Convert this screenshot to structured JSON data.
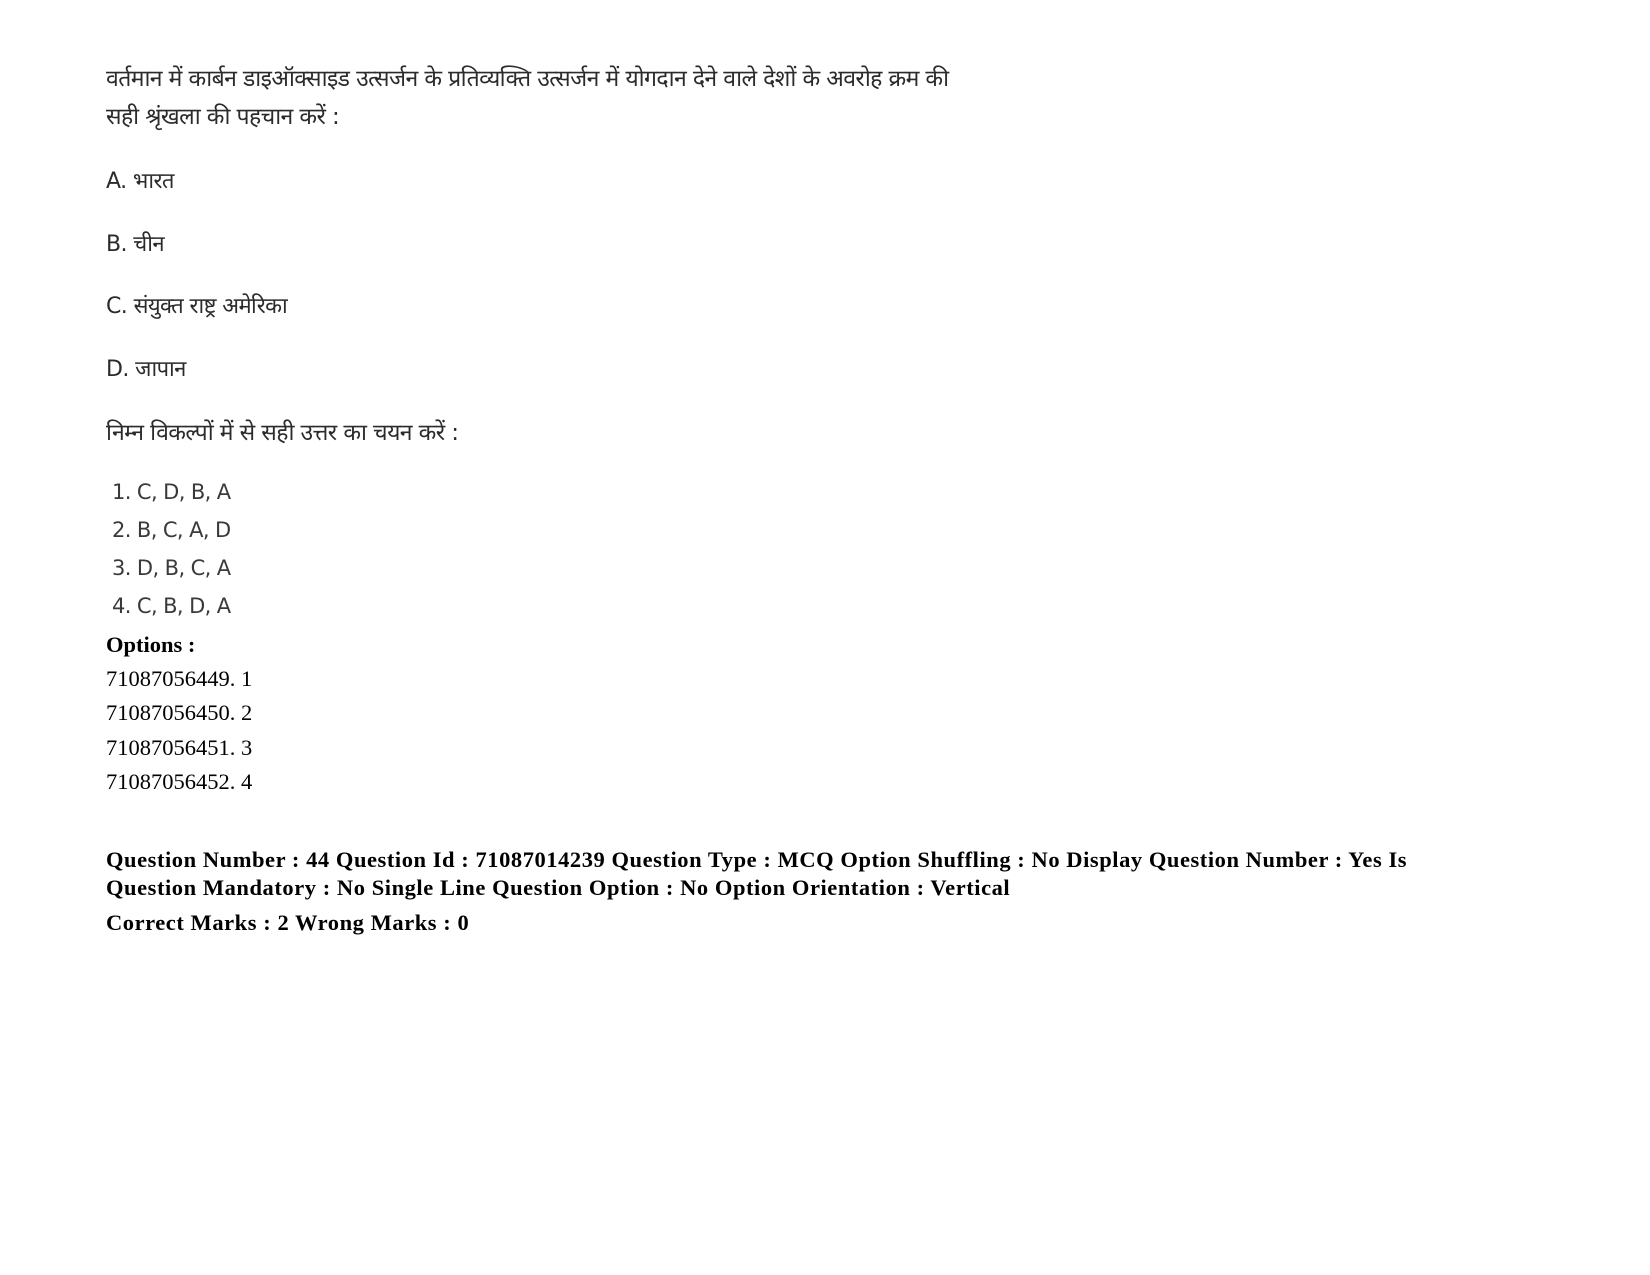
{
  "question": {
    "text_line1": "वर्तमान में कार्बन डाइऑक्साइड उत्सर्जन के प्रतिव्यक्ति उत्सर्जन में योगदान देने वाले देशों के अवरोह क्रम की",
    "text_line2": "सही श्रृंखला की पहचान करें :",
    "statements": [
      {
        "label": "A.",
        "text": "भारत"
      },
      {
        "label": "B.",
        "text": "चीन"
      },
      {
        "label": "C.",
        "text": "संयुक्त राष्ट्र अमेरिका"
      },
      {
        "label": "D.",
        "text": "जापान"
      }
    ],
    "instruction": "निम्न विकल्पों में से सही उत्तर का चयन करें :",
    "choices": [
      "1. C, D, B, A",
      "2. B, C, A, D",
      "3. D, B, C, A",
      "4. C, B, D, A"
    ]
  },
  "options": {
    "label": "Options :",
    "items": [
      "71087056449. 1",
      "71087056450. 2",
      "71087056451. 3",
      "71087056452. 4"
    ]
  },
  "meta": {
    "line1": "Question Number : 44 Question Id : 71087014239 Question Type : MCQ Option Shuffling : No Display Question Number : Yes Is",
    "line2": "Question Mandatory : No Single Line Question Option : No Option Orientation : Vertical",
    "marks": "Correct Marks : 2 Wrong Marks : 0"
  }
}
